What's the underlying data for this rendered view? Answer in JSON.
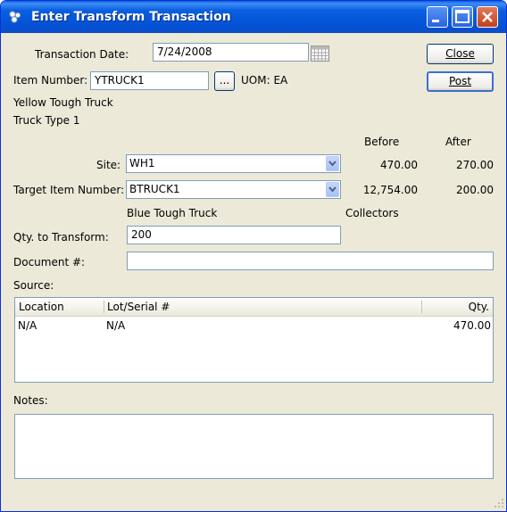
{
  "window": {
    "title": "Enter Transform Transaction"
  },
  "form": {
    "transaction_date_label": "Transaction Date:",
    "transaction_date": "7/24/2008",
    "item_number_label": "Item Number:",
    "item_number": "YTRUCK1",
    "lookup_button": "...",
    "uom_label": "UOM: EA",
    "item_desc1": "Yellow Tough Truck",
    "item_desc2": "Truck Type 1",
    "before_header": "Before",
    "after_header": "After",
    "site_label": "Site:",
    "site_value": "WH1",
    "site_before": "470.00",
    "site_after": "270.00",
    "target_label": "Target Item Number:",
    "target_value": "BTRUCK1",
    "target_before": "12,754.00",
    "target_after": "200.00",
    "target_desc1": "Blue Tough Truck",
    "target_desc2": "Collectors",
    "qty_label": "Qty. to Transform:",
    "qty_value": "200",
    "document_label": "Document #:",
    "document_value": "",
    "source_label": "Source:",
    "notes_label": "Notes:"
  },
  "buttons": {
    "close": "Close",
    "post": "Post"
  },
  "source_table": {
    "columns": [
      "Location",
      "Lot/Serial #",
      "Qty."
    ],
    "rows": [
      {
        "location": "N/A",
        "lot_serial": "N/A",
        "qty": "470.00"
      }
    ]
  }
}
